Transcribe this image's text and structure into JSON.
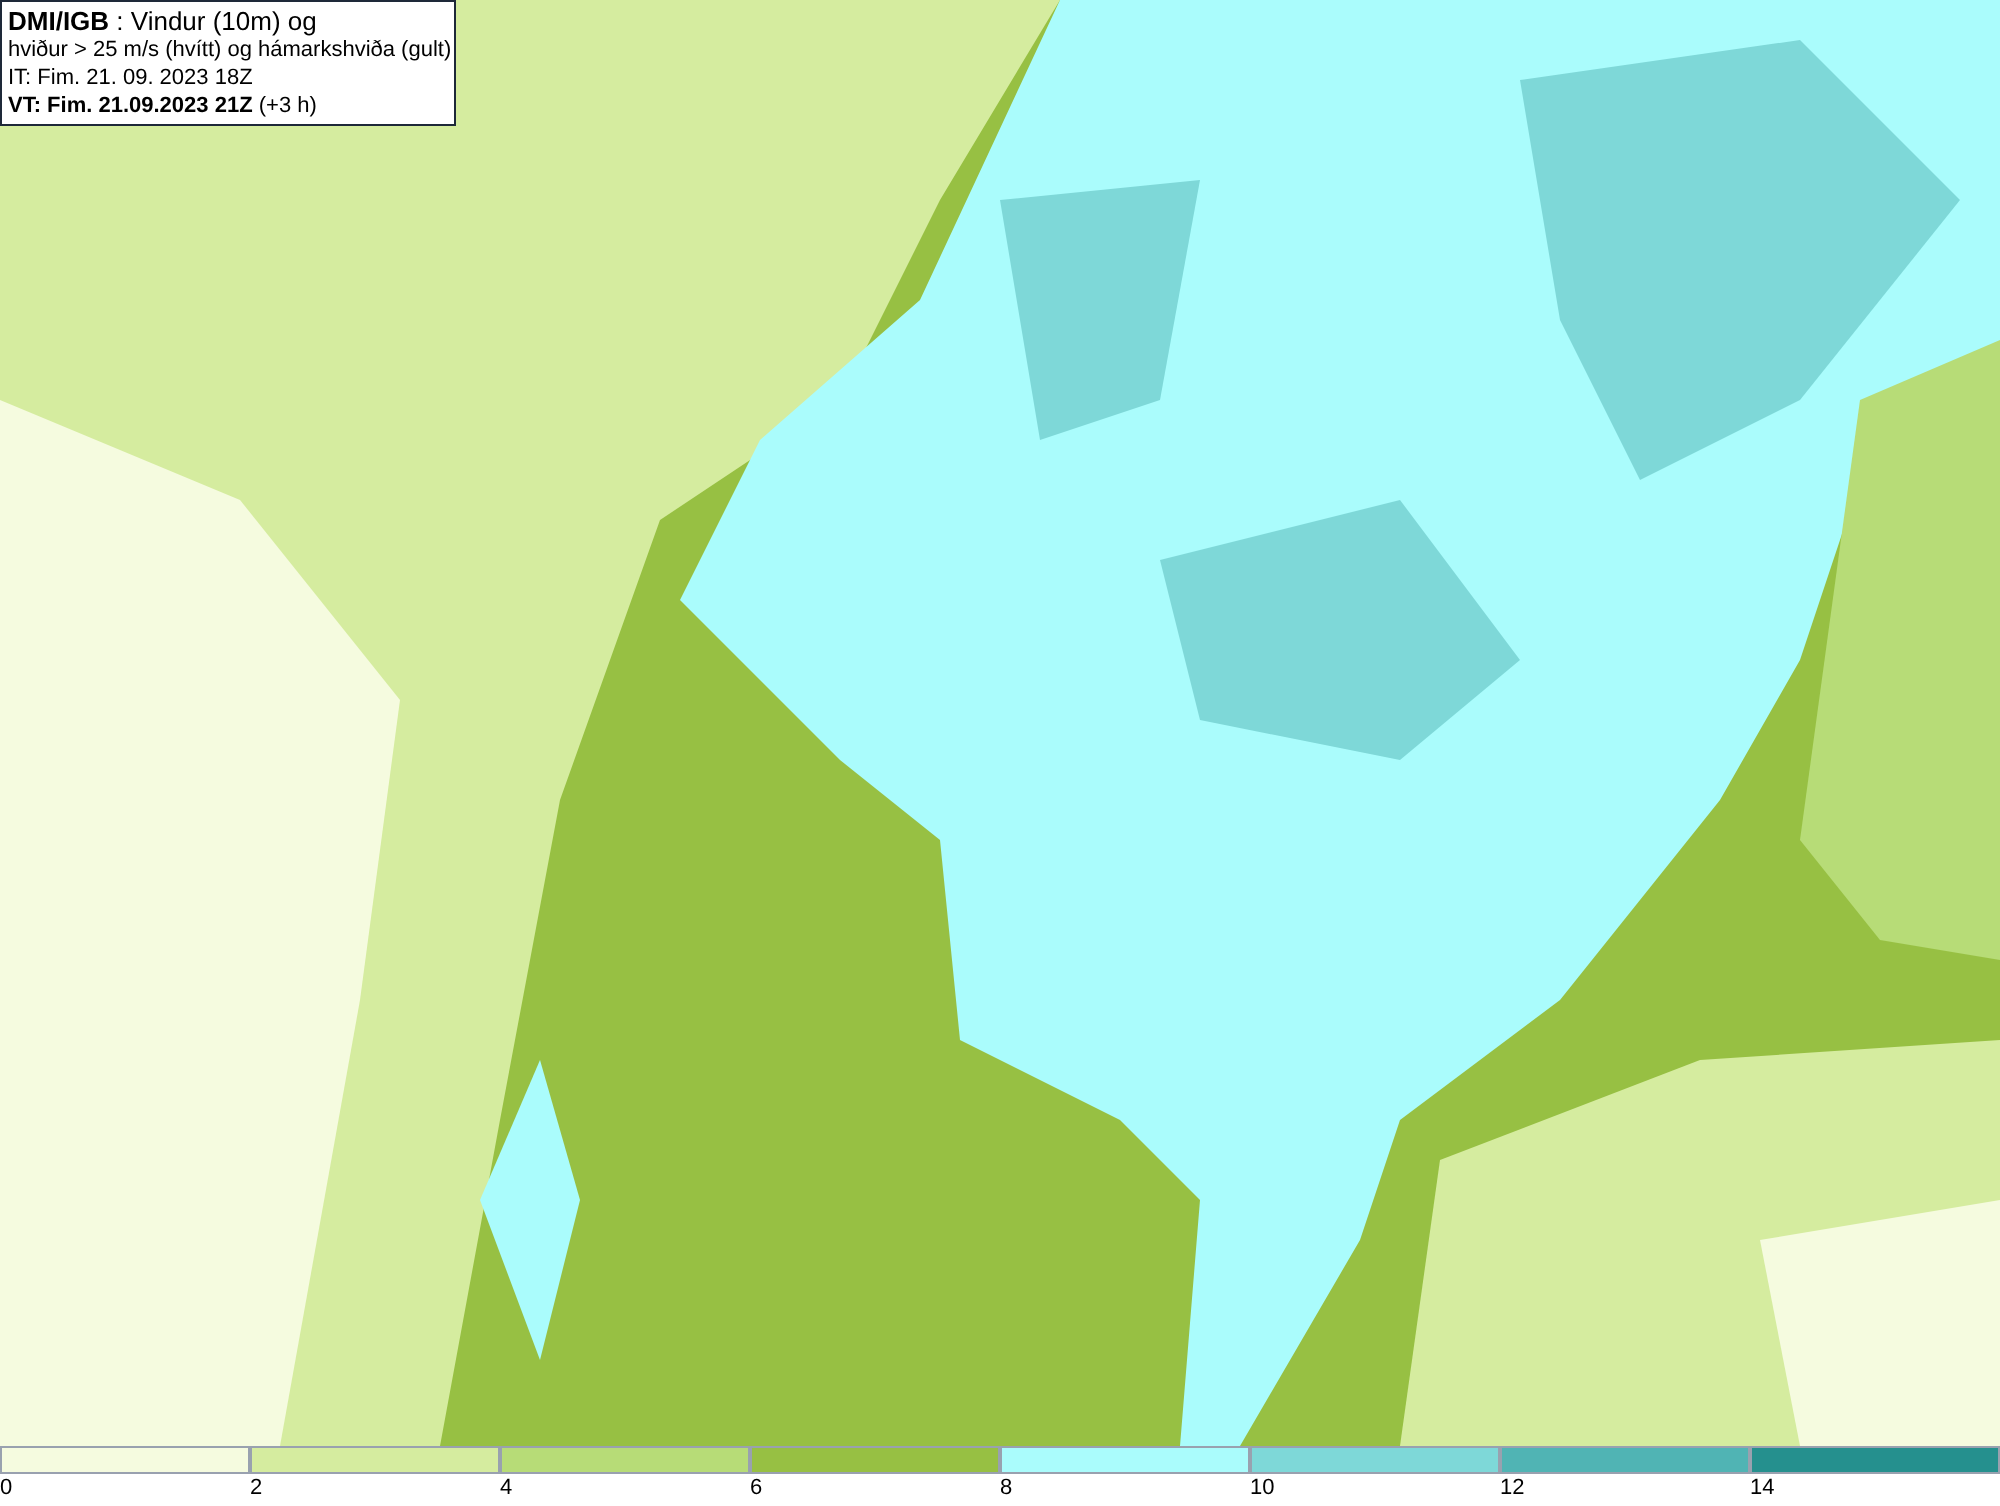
{
  "title_box": {
    "lines": [
      "**DMI/IGB** : Vindur (10m) og",
      "hviður > 25 m/s (hvítt) og hámarkshviða (gult)",
      "IT: Fim. 21. 09. 2023 18Z",
      "**VT: Fim. 21.09.2023 21Z** (+3 h)"
    ]
  },
  "legend": [
    {
      "label": "0",
      "color": "#f5fbdf"
    },
    {
      "label": "2",
      "color": "#d5ec9f"
    },
    {
      "label": "4",
      "color": "#b7dc77"
    },
    {
      "label": "6",
      "color": "#97c043"
    },
    {
      "label": "8",
      "color": "#aafcfc"
    },
    {
      "label": "10",
      "color": "#7ed8d8"
    },
    {
      "label": "12",
      "color": "#50b4b4"
    },
    {
      "label": "14",
      "color": "#25908e"
    }
  ]
}
